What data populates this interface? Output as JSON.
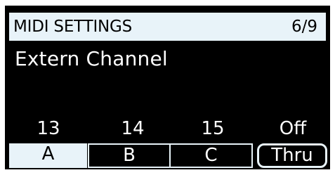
{
  "header": {
    "title": "MIDI SETTINGS",
    "page": "6/9"
  },
  "parameter": {
    "label": "Extern Channel"
  },
  "values": [
    "13",
    "14",
    "15",
    "Off"
  ],
  "softkeys": [
    {
      "label": "A",
      "selected": true
    },
    {
      "label": "B",
      "selected": false
    },
    {
      "label": "C",
      "selected": false
    },
    {
      "label": "Thru",
      "selected": false
    }
  ],
  "colors": {
    "screen_bg": "#000000",
    "highlight": "#e8f3f9",
    "text_light": "#ffffff",
    "text_dark": "#000000"
  }
}
